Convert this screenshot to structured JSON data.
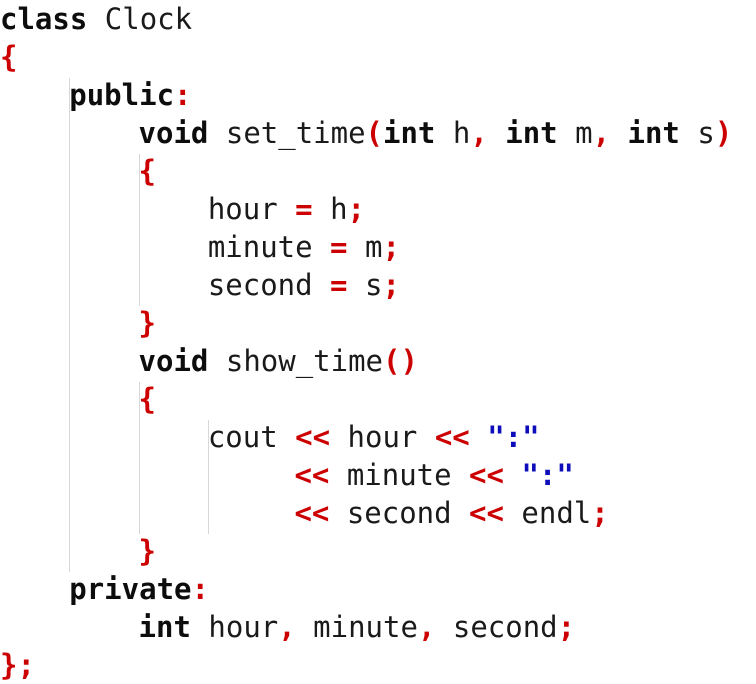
{
  "editor": {
    "language": "C++",
    "background_color": "#ffffff",
    "font_family_hint": "monospace",
    "colors": {
      "text": "#1a1a1a",
      "keyword": "#0d0d0d",
      "punctuation": "#cc0000",
      "operator": "#cc0000",
      "string": "#0d0dbb",
      "indent_guide": "#d8d8d8"
    }
  },
  "code": {
    "full_text": "class Clock\n{\n    public:\n        void set_time(int h, int m, int s)\n        {\n            hour = h;\n            minute = m;\n            second = s;\n        }\n        void show_time()\n        {\n            cout << hour << \":\"\n                 << minute << \":\"\n                 << second << endl;\n        }\n    private:\n        int hour, minute, second;\n};",
    "lines": [
      {
        "indent": 0,
        "tokens": [
          {
            "t": "class",
            "k": "keyword"
          },
          {
            "t": " ",
            "k": "plain"
          },
          {
            "t": "Clock",
            "k": "plain"
          }
        ]
      },
      {
        "indent": 0,
        "tokens": [
          {
            "t": "{",
            "k": "punct"
          }
        ]
      },
      {
        "indent": 4,
        "tokens": [
          {
            "t": "public",
            "k": "keyword"
          },
          {
            "t": ":",
            "k": "punct"
          }
        ]
      },
      {
        "indent": 8,
        "tokens": [
          {
            "t": "void",
            "k": "keyword"
          },
          {
            "t": " ",
            "k": "plain"
          },
          {
            "t": "set_time",
            "k": "plain"
          },
          {
            "t": "(",
            "k": "punct"
          },
          {
            "t": "int",
            "k": "keyword"
          },
          {
            "t": " h",
            "k": "plain"
          },
          {
            "t": ",",
            "k": "punct"
          },
          {
            "t": " ",
            "k": "plain"
          },
          {
            "t": "int",
            "k": "keyword"
          },
          {
            "t": " m",
            "k": "plain"
          },
          {
            "t": ",",
            "k": "punct"
          },
          {
            "t": " ",
            "k": "plain"
          },
          {
            "t": "int",
            "k": "keyword"
          },
          {
            "t": " s",
            "k": "plain"
          },
          {
            "t": ")",
            "k": "punct"
          }
        ]
      },
      {
        "indent": 8,
        "tokens": [
          {
            "t": "{",
            "k": "punct"
          }
        ]
      },
      {
        "indent": 12,
        "tokens": [
          {
            "t": "hour ",
            "k": "plain"
          },
          {
            "t": "=",
            "k": "op"
          },
          {
            "t": " h",
            "k": "plain"
          },
          {
            "t": ";",
            "k": "punct"
          }
        ]
      },
      {
        "indent": 12,
        "tokens": [
          {
            "t": "minute ",
            "k": "plain"
          },
          {
            "t": "=",
            "k": "op"
          },
          {
            "t": " m",
            "k": "plain"
          },
          {
            "t": ";",
            "k": "punct"
          }
        ]
      },
      {
        "indent": 12,
        "tokens": [
          {
            "t": "second ",
            "k": "plain"
          },
          {
            "t": "=",
            "k": "op"
          },
          {
            "t": " s",
            "k": "plain"
          },
          {
            "t": ";",
            "k": "punct"
          }
        ]
      },
      {
        "indent": 8,
        "tokens": [
          {
            "t": "}",
            "k": "punct"
          }
        ]
      },
      {
        "indent": 8,
        "tokens": [
          {
            "t": "void",
            "k": "keyword"
          },
          {
            "t": " ",
            "k": "plain"
          },
          {
            "t": "show_time",
            "k": "plain"
          },
          {
            "t": "()",
            "k": "punct"
          }
        ]
      },
      {
        "indent": 8,
        "tokens": [
          {
            "t": "{",
            "k": "punct"
          }
        ]
      },
      {
        "indent": 12,
        "tokens": [
          {
            "t": "cout ",
            "k": "plain"
          },
          {
            "t": "<<",
            "k": "op"
          },
          {
            "t": " hour ",
            "k": "plain"
          },
          {
            "t": "<<",
            "k": "op"
          },
          {
            "t": " ",
            "k": "plain"
          },
          {
            "t": "\":\"",
            "k": "string"
          }
        ]
      },
      {
        "indent": 17,
        "tokens": [
          {
            "t": "<<",
            "k": "op"
          },
          {
            "t": " minute ",
            "k": "plain"
          },
          {
            "t": "<<",
            "k": "op"
          },
          {
            "t": " ",
            "k": "plain"
          },
          {
            "t": "\":\"",
            "k": "string"
          }
        ]
      },
      {
        "indent": 17,
        "tokens": [
          {
            "t": "<<",
            "k": "op"
          },
          {
            "t": " second ",
            "k": "plain"
          },
          {
            "t": "<<",
            "k": "op"
          },
          {
            "t": " endl",
            "k": "plain"
          },
          {
            "t": ";",
            "k": "punct"
          }
        ]
      },
      {
        "indent": 8,
        "tokens": [
          {
            "t": "}",
            "k": "punct"
          }
        ]
      },
      {
        "indent": 4,
        "tokens": [
          {
            "t": "private",
            "k": "keyword"
          },
          {
            "t": ":",
            "k": "punct"
          }
        ]
      },
      {
        "indent": 8,
        "tokens": [
          {
            "t": "int",
            "k": "keyword"
          },
          {
            "t": " hour",
            "k": "plain"
          },
          {
            "t": ",",
            "k": "punct"
          },
          {
            "t": " minute",
            "k": "plain"
          },
          {
            "t": ",",
            "k": "punct"
          },
          {
            "t": " second",
            "k": "plain"
          },
          {
            "t": ";",
            "k": "punct"
          }
        ]
      },
      {
        "indent": 0,
        "tokens": [
          {
            "t": "}",
            "k": "punct"
          },
          {
            "t": ";",
            "k": "punct"
          }
        ]
      }
    ],
    "indent_guides": [
      {
        "col": 4,
        "from_line": 2,
        "to_line": 14
      },
      {
        "col": 8,
        "from_line": 4,
        "to_line": 7
      },
      {
        "col": 8,
        "from_line": 10,
        "to_line": 13
      },
      {
        "col": 12,
        "from_line": 11,
        "to_line": 13
      }
    ]
  }
}
